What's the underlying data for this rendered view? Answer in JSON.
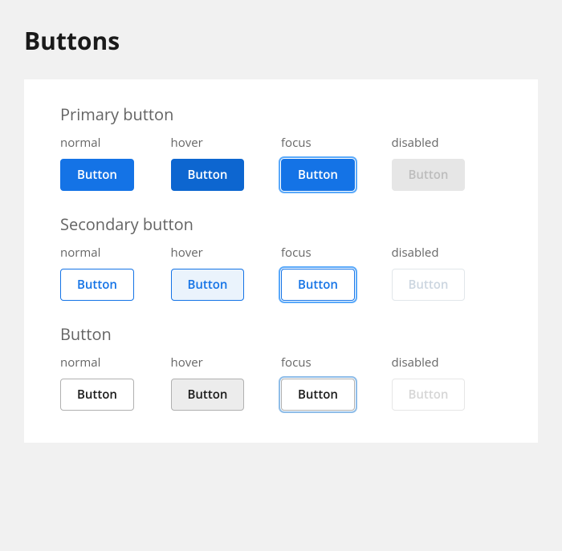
{
  "page_title": "Buttons",
  "states": {
    "normal": "normal",
    "hover": "hover",
    "focus": "focus",
    "disabled": "disabled"
  },
  "button_label": "Button",
  "sections": {
    "primary": {
      "title": "Primary button"
    },
    "secondary": {
      "title": "Secondary button"
    },
    "default": {
      "title": "Button"
    }
  }
}
